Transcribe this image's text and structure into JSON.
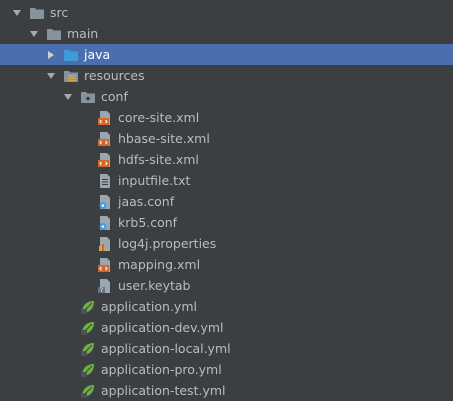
{
  "tree": {
    "nodes": [
      {
        "id": "src",
        "label": "src",
        "type": "folder",
        "expanded": true
      },
      {
        "id": "main",
        "label": "main",
        "type": "folder",
        "expanded": true
      },
      {
        "id": "java",
        "label": "java",
        "type": "source-folder",
        "expanded": false,
        "selected": true
      },
      {
        "id": "resources",
        "label": "resources",
        "type": "resources-folder",
        "expanded": true
      },
      {
        "id": "conf",
        "label": "conf",
        "type": "package-folder",
        "expanded": true
      },
      {
        "id": "core-site",
        "label": "core-site.xml",
        "type": "xml-file"
      },
      {
        "id": "hbase-site",
        "label": "hbase-site.xml",
        "type": "xml-file"
      },
      {
        "id": "hdfs-site",
        "label": "hdfs-site.xml",
        "type": "xml-file"
      },
      {
        "id": "inputfile",
        "label": "inputfile.txt",
        "type": "text-file"
      },
      {
        "id": "jaas",
        "label": "jaas.conf",
        "type": "conf-file"
      },
      {
        "id": "krb5",
        "label": "krb5.conf",
        "type": "conf-file"
      },
      {
        "id": "log4j",
        "label": "log4j.properties",
        "type": "properties-file"
      },
      {
        "id": "mapping",
        "label": "mapping.xml",
        "type": "xml-file"
      },
      {
        "id": "keytab",
        "label": "user.keytab",
        "type": "unknown-file"
      },
      {
        "id": "app",
        "label": "application.yml",
        "type": "spring-yml"
      },
      {
        "id": "app-dev",
        "label": "application-dev.yml",
        "type": "spring-yml"
      },
      {
        "id": "app-local",
        "label": "application-local.yml",
        "type": "spring-yml"
      },
      {
        "id": "app-pro",
        "label": "application-pro.yml",
        "type": "spring-yml"
      },
      {
        "id": "app-test",
        "label": "application-test.yml",
        "type": "spring-yml"
      }
    ]
  },
  "colors": {
    "background": "#3c3f41",
    "selection": "#4b6eaf",
    "text": "#bbbbbb",
    "folder": "#87939a",
    "source_folder": "#3d9bd8",
    "xml_badge": "#d0672d",
    "spring_leaf": "#6db33f"
  }
}
